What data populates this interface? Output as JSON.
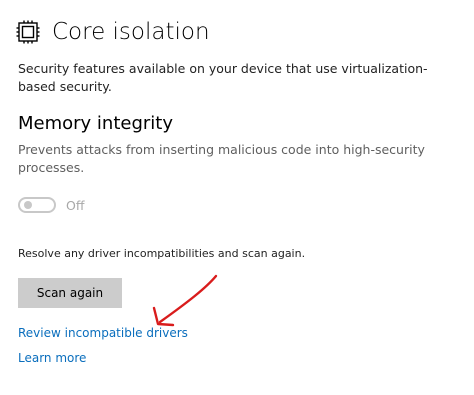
{
  "header": {
    "title": "Core isolation",
    "icon": "core-isolation-chip-icon"
  },
  "intro": {
    "description": "Security features available on your device that use virtualization-based security."
  },
  "memory_integrity": {
    "title": "Memory integrity",
    "description": "Prevents attacks from inserting malicious code into high-security processes.",
    "toggle_state_label": "Off",
    "toggle_on": false
  },
  "driver_section": {
    "resolve_text": "Resolve any driver incompatibilities and scan again.",
    "scan_button_label": "Scan again"
  },
  "links": {
    "review_incompatible_drivers": "Review incompatible drivers",
    "learn_more": "Learn more"
  },
  "colors": {
    "link": "#0a6ebd",
    "button_bg": "#cccccc",
    "toggle_off": "#c8c8c8",
    "annotation_arrow": "#d91c1c"
  }
}
